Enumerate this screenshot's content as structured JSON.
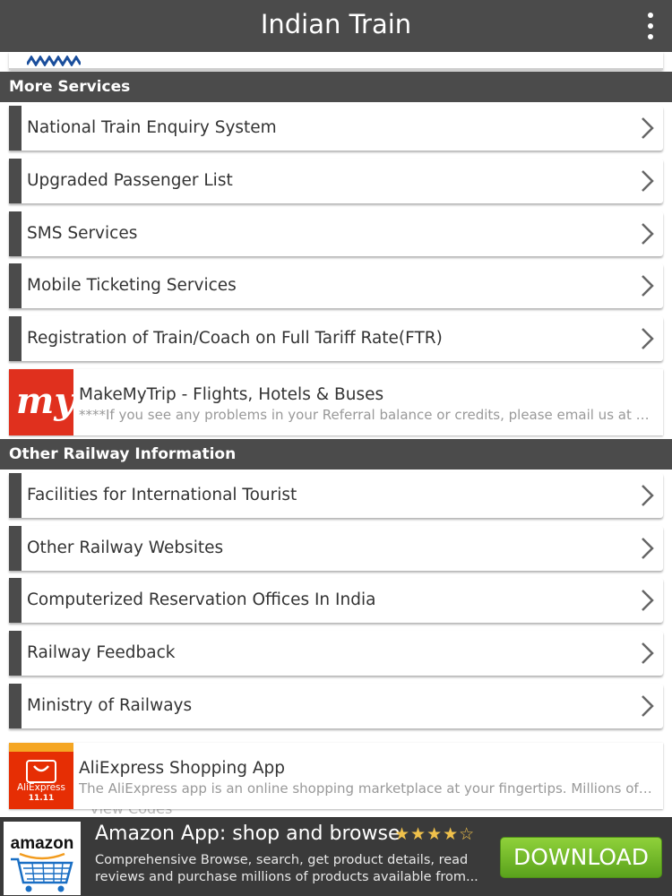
{
  "app": {
    "title": "Indian Train"
  },
  "sections": {
    "more_services": "More Services",
    "other_railway": "Other Railway Information"
  },
  "more_services_items": [
    {
      "label": "National Train Enquiry System"
    },
    {
      "label": "Upgraded Passenger List"
    },
    {
      "label": "SMS Services"
    },
    {
      "label": "Mobile Ticketing Services"
    },
    {
      "label": "Registration of Train/Coach on Full Tariff Rate(FTR)"
    }
  ],
  "ad_makemytrip": {
    "logo_text": "my",
    "title": "MakeMyTrip - Flights, Hotels & Buses",
    "description": "****If you see any problems in your Referral balance or credits, please email us at mobile@makemytrip.com"
  },
  "other_railway_items": [
    {
      "label": "Facilities for International Tourist"
    },
    {
      "label": "Other Railway Websites"
    },
    {
      "label": "Computerized Reservation Offices In India"
    },
    {
      "label": "Railway Feedback"
    },
    {
      "label": "Ministry of Railways"
    }
  ],
  "ad_aliexpress": {
    "logo_text": "AliExpress",
    "logo_sub": "11.11",
    "title": "AliExpress Shopping App",
    "description": "The AliExpress app is an online shopping marketplace at your fingertips. Millions of products"
  },
  "ghost_text": "View Codes",
  "banner": {
    "logo_text": "amazon",
    "title": "Amazon App: shop and browse",
    "stars": "★★★★☆",
    "rating": 3.5,
    "description": "Comprehensive Browse, search, get product details, read reviews and purchase millions of products available from...",
    "button": "DOWNLOAD"
  },
  "colors": {
    "header": "#4b4b4b",
    "makemytrip": "#e0301e",
    "aliexpress": "#e62e04",
    "download": "#6bb526",
    "star": "#f0c14b"
  }
}
